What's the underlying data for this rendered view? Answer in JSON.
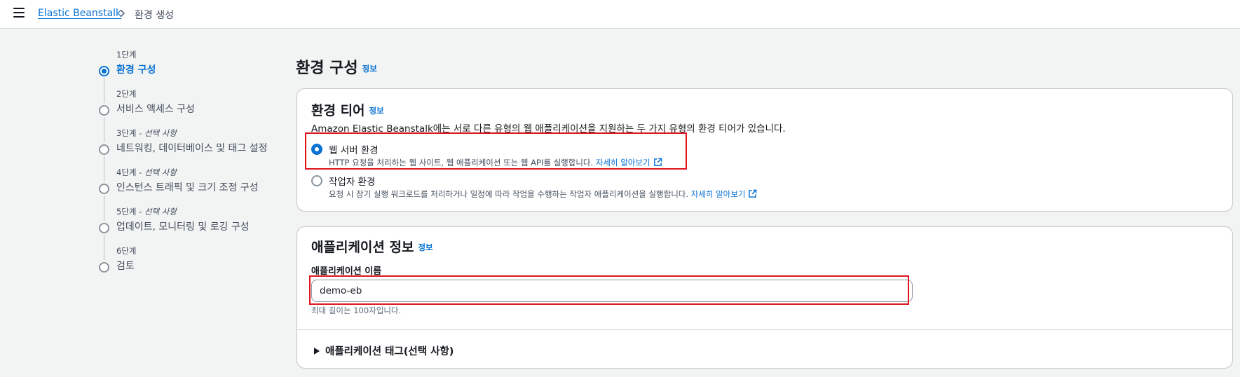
{
  "breadcrumb": {
    "root": "Elastic Beanstalk",
    "current": "환경 생성"
  },
  "steps": [
    {
      "num": "1단계",
      "optional": "",
      "label": "환경 구성"
    },
    {
      "num": "2단계",
      "optional": "",
      "label": "서비스 액세스 구성"
    },
    {
      "num": "3단계 - ",
      "optional": "선택 사항",
      "label": "네트워킹, 데이터베이스 및 태그 설정"
    },
    {
      "num": "4단계 - ",
      "optional": "선택 사항",
      "label": "인스턴스 트래픽 및 크기 조정 구성"
    },
    {
      "num": "5단계 - ",
      "optional": "선택 사항",
      "label": "업데이트, 모니터링 및 로깅 구성"
    },
    {
      "num": "6단계",
      "optional": "",
      "label": "검토"
    }
  ],
  "page": {
    "title": "환경 구성",
    "info": "정보"
  },
  "tier": {
    "title": "환경 티어",
    "info": "정보",
    "description": "Amazon Elastic Beanstalk에는 서로 다른 유형의 웹 애플리케이션을 지원하는 두 가지 유형의 환경 티어가 있습니다.",
    "options": [
      {
        "label": "웹 서버 환경",
        "desc": "HTTP 요청을 처리하는 웹 사이트, 웹 애플리케이션 또는 웹 API를 실행합니다.",
        "link": "자세히 알아보기",
        "selected": true
      },
      {
        "label": "작업자 환경",
        "desc": "요청 시 장기 실행 워크로드를 처리하거나 일정에 따라 작업을 수행하는 작업자 애플리케이션을 실행합니다.",
        "link": "자세히 알아보기",
        "selected": false
      }
    ]
  },
  "app": {
    "title": "애플리케이션 정보",
    "info": "정보",
    "name_label": "애플리케이션 이름",
    "name_value": "demo-eb",
    "hint": "최대 길이는 100자입니다.",
    "tags_label": "애플리케이션 태그(선택 사항)"
  },
  "colors": {
    "accent": "#0972d3",
    "highlight": "#e0141e"
  }
}
